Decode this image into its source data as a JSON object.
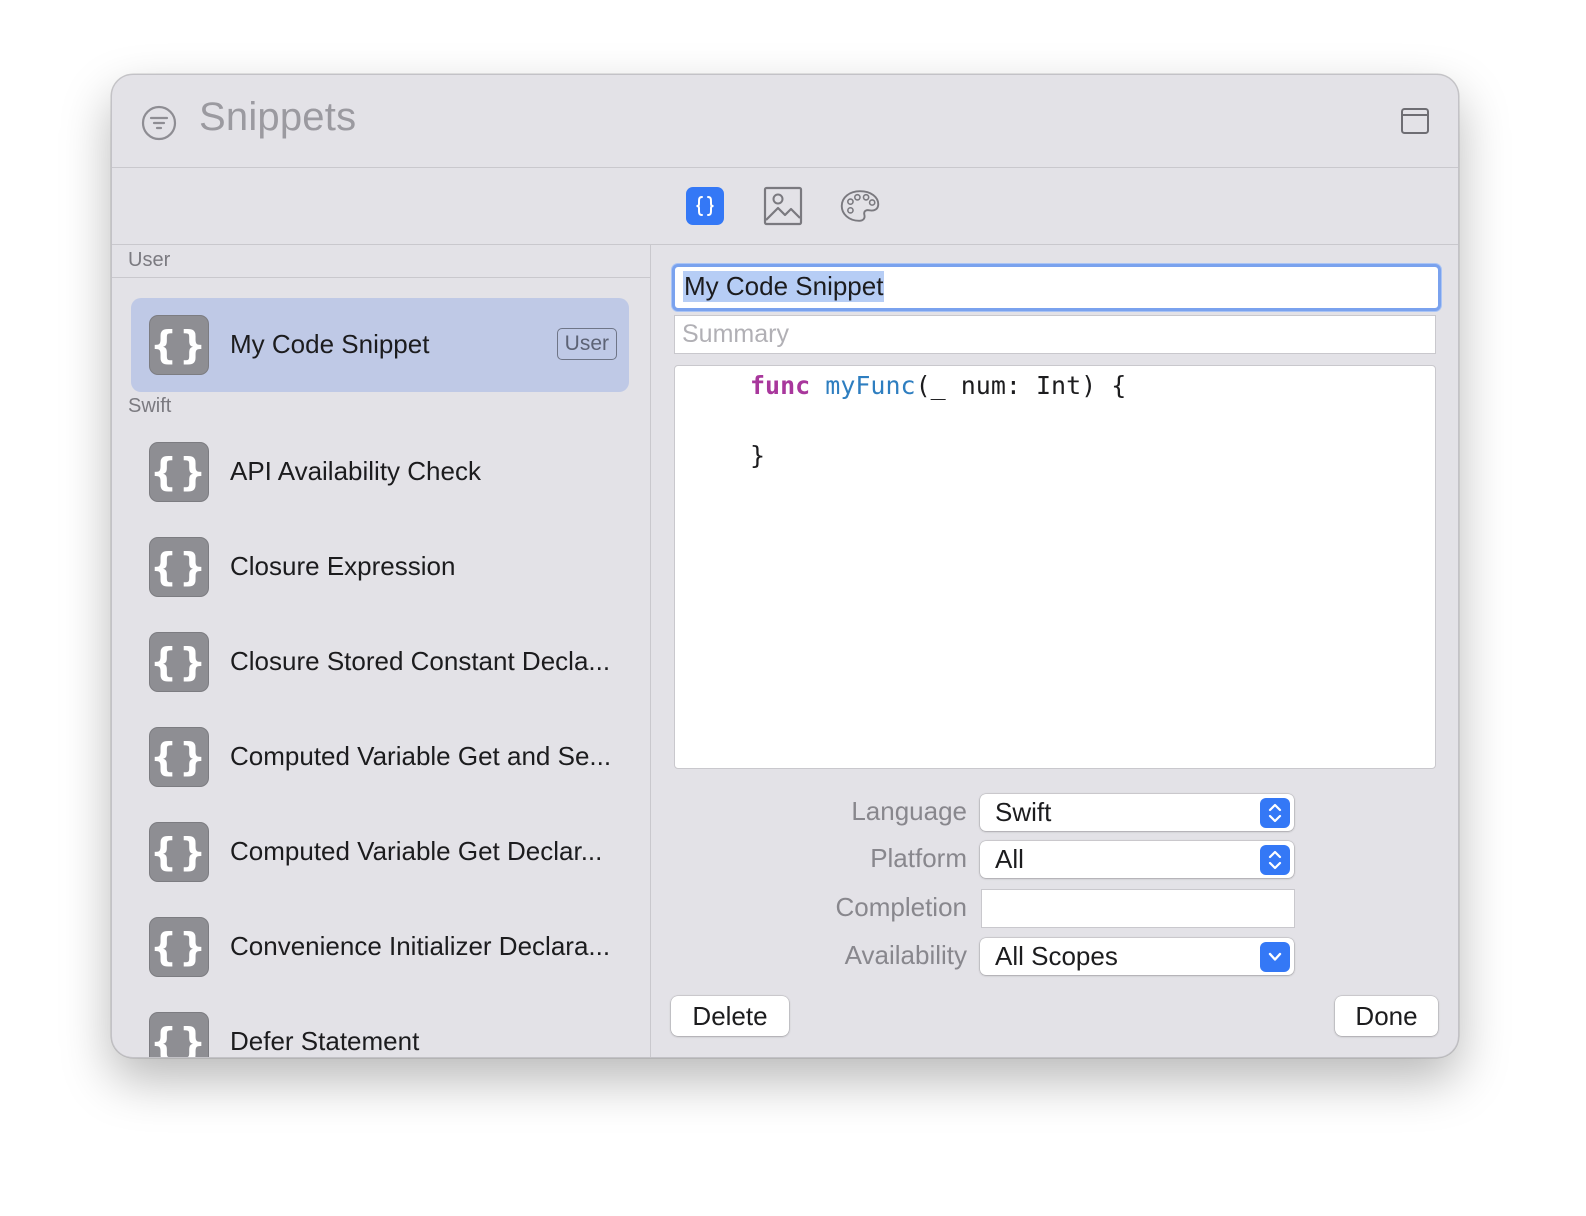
{
  "window": {
    "title": "Snippets",
    "title_icon": "filter-icon",
    "layout_icon": "window-layout-icon"
  },
  "toolbar": {
    "tabs": [
      {
        "icon": "code-braces-icon",
        "selected": true
      },
      {
        "icon": "image-icon",
        "selected": false
      },
      {
        "icon": "palette-icon",
        "selected": false
      }
    ]
  },
  "sidebar": {
    "sections": [
      {
        "header": "User",
        "items": [
          {
            "label": "My Code Snippet",
            "badge": "User",
            "icon": "snippet-braces-icon",
            "selected": true
          }
        ]
      },
      {
        "header": "Swift",
        "items": [
          {
            "label": "API Availability Check",
            "icon": "snippet-braces-icon"
          },
          {
            "label": "Closure Expression",
            "icon": "snippet-braces-icon"
          },
          {
            "label": "Closure Stored Constant Decla...",
            "icon": "snippet-braces-icon"
          },
          {
            "label": "Computed Variable Get and Se...",
            "icon": "snippet-braces-icon"
          },
          {
            "label": "Computed Variable Get Declar...",
            "icon": "snippet-braces-icon"
          },
          {
            "label": "Convenience Initializer Declara...",
            "icon": "snippet-braces-icon"
          },
          {
            "label": "Defer Statement",
            "icon": "snippet-braces-icon"
          }
        ]
      }
    ],
    "icon_glyph": "{}"
  },
  "editor": {
    "name_value": "My Code Snippet",
    "summary_placeholder": "Summary",
    "code": {
      "line1_keyword": "func",
      "line1_name": "myFunc",
      "line1_rest": "(_ num: Int) {",
      "line2": "",
      "line3": "}"
    },
    "form": {
      "language_label": "Language",
      "language_value": "Swift",
      "platform_label": "Platform",
      "platform_value": "All",
      "completion_label": "Completion",
      "completion_value": "",
      "availability_label": "Availability",
      "availability_value": "All Scopes"
    },
    "delete_label": "Delete",
    "done_label": "Done"
  },
  "colors": {
    "accent": "#3478f6",
    "selection": "#bfc9e6",
    "keyword": "#a8379c",
    "function_name": "#2e7ec0"
  }
}
